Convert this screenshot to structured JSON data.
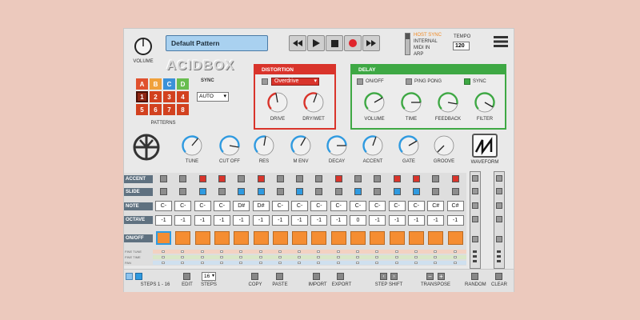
{
  "header": {
    "volume_label": "VOLUME",
    "pattern_name": "Default Pattern",
    "logo": "ACIDBOX",
    "sync_options": [
      "HOST SYNC",
      "INTERNAL",
      "MIDI IN",
      "ARP"
    ],
    "sync_selected": "HOST SYNC",
    "tempo_label": "TEMPO",
    "tempo_value": "120"
  },
  "patterns": {
    "banks": [
      "A",
      "B",
      "C",
      "D"
    ],
    "numbers": [
      "1",
      "2",
      "3",
      "4",
      "5",
      "6",
      "7",
      "8"
    ],
    "label": "PATTERNS",
    "sync_label": "SYNC",
    "sync_value": "AUTO"
  },
  "distortion": {
    "title": "DISTORTION",
    "type": "Overdrive",
    "knobs": [
      "DRIVE",
      "DRY/WET"
    ]
  },
  "delay": {
    "title": "DELAY",
    "toggles": [
      "ON/OFF",
      "PING PONG",
      "SYNC"
    ],
    "knobs": [
      "VOLUME",
      "TIME",
      "FEEDBACK",
      "FILTER"
    ]
  },
  "synth": {
    "knobs": [
      "TUNE",
      "CUT OFF",
      "RES",
      "M ENV",
      "DECAY",
      "ACCENT",
      "GATE",
      "GROOVE"
    ],
    "waveform_label": "WAVEFORM"
  },
  "sequencer": {
    "row_labels": [
      "ACCENT",
      "SLIDE",
      "NOTE",
      "OCTAVE",
      "ON/OFF"
    ],
    "accent": [
      0,
      0,
      1,
      1,
      0,
      1,
      0,
      0,
      0,
      1,
      0,
      0,
      1,
      1,
      0,
      1
    ],
    "slide": [
      0,
      0,
      1,
      0,
      1,
      1,
      0,
      1,
      0,
      0,
      1,
      0,
      1,
      1,
      0,
      0
    ],
    "notes": [
      "C-",
      "C-",
      "C-",
      "C-",
      "D#",
      "D#",
      "C-",
      "C-",
      "C-",
      "C-",
      "C-",
      "C-",
      "C-",
      "C-",
      "C#",
      "C#"
    ],
    "octaves": [
      "-1",
      "-1",
      "-1",
      "-1",
      "-1",
      "-1",
      "-1",
      "-1",
      "-1",
      "-1",
      "0",
      "-1",
      "-1",
      "-1",
      "-1",
      "-1"
    ],
    "onoff": [
      1,
      1,
      1,
      1,
      1,
      1,
      1,
      1,
      1,
      1,
      1,
      1,
      1,
      1,
      1,
      1
    ],
    "fine_labels": [
      "FINE TUNE",
      "FINE TIME",
      "PAN"
    ]
  },
  "footer": {
    "steps_range": "STEPS 1 - 16",
    "edit": "EDIT",
    "steps_value": "16",
    "steps": "STEPS",
    "copy": "COPY",
    "paste": "PASTE",
    "import": "IMPORT",
    "export": "EXPORT",
    "step_shift": "STEP SHIFT",
    "transpose": "TRANSPOSE",
    "random": "RANDOM",
    "clear": "CLEAR"
  },
  "colors": {
    "red": "#d9342b",
    "green": "#3ea844",
    "blue": "#2f9ae0",
    "orange": "#f58d32",
    "label_bg": "#5f7180"
  }
}
